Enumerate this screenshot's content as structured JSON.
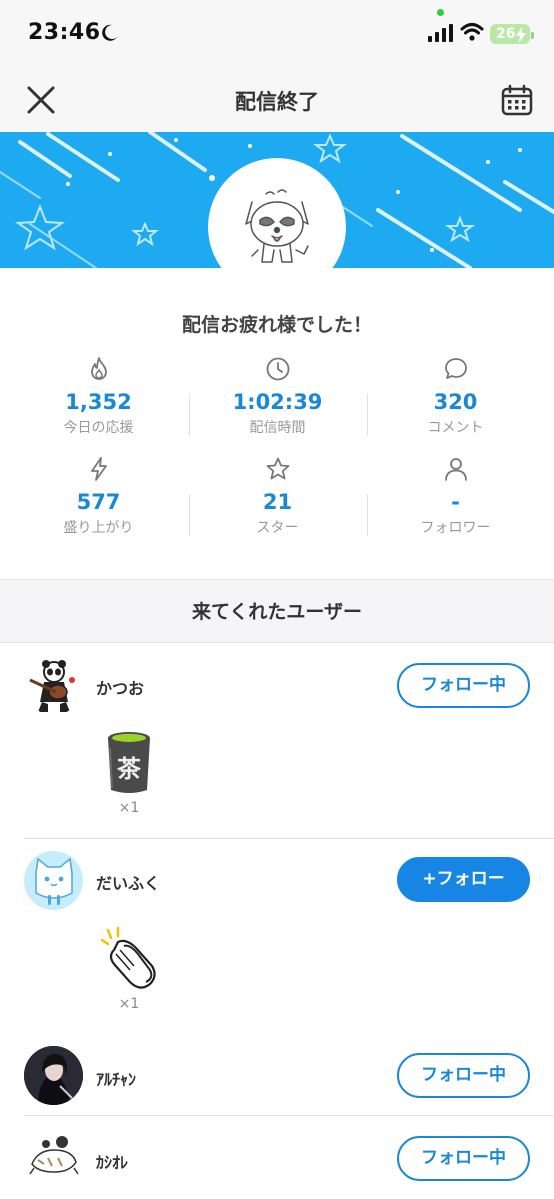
{
  "status_bar": {
    "time": "23:46",
    "battery": "26"
  },
  "nav": {
    "title": "配信終了"
  },
  "greeting": "配信お疲れ様でした！",
  "stats": [
    {
      "icon": "flame-icon",
      "value": "1,352",
      "label": "今日の応援"
    },
    {
      "icon": "clock-icon",
      "value": "1:02:39",
      "label": "配信時間"
    },
    {
      "icon": "comment-icon",
      "value": "320",
      "label": "コメント"
    },
    {
      "icon": "lightning-icon",
      "value": "577",
      "label": "盛り上がり"
    },
    {
      "icon": "star-icon",
      "value": "21",
      "label": "スター"
    },
    {
      "icon": "person-icon",
      "value": "-",
      "label": "フォロワー"
    }
  ],
  "section_title": "来てくれたユーザー",
  "users": [
    {
      "name": "かつお",
      "button": "フォロー中",
      "gift": {
        "icon": "tea-cup-icon",
        "label": "茶",
        "count": "×1"
      }
    },
    {
      "name": "だいふく",
      "button": "+フォロー",
      "gift": {
        "icon": "clap-hands-icon",
        "count": "×1"
      }
    },
    {
      "name": "ｱﾙﾁｬﾝ",
      "button": "フォロー中"
    },
    {
      "name": "ｶｼｵﾚ",
      "button": "フォロー中"
    }
  ],
  "colors": {
    "accent": "#1a88d6",
    "banner": "#1eaaf1",
    "follow_button": "#1785e3"
  }
}
